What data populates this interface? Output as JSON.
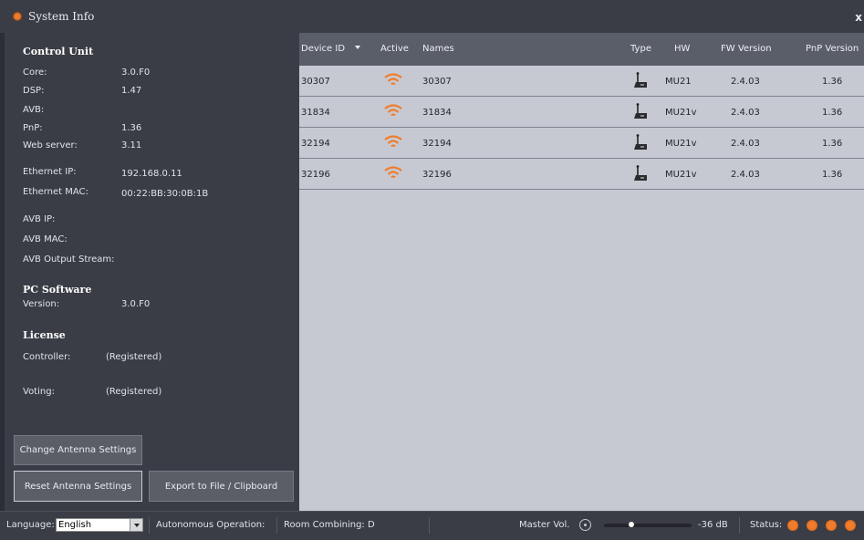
{
  "window": {
    "title": "System Info",
    "close_label": "x"
  },
  "control_unit": {
    "title": "Control Unit",
    "items": [
      {
        "label": "Core:",
        "value": "3.0.F0"
      },
      {
        "label": "DSP:",
        "value": "1.47"
      },
      {
        "label": "AVB:",
        "value": ""
      },
      {
        "label": "PnP:",
        "value": "1.36"
      },
      {
        "label": "Web server:",
        "value": "3.11"
      },
      {
        "label": "Ethernet IP:",
        "value": "192.168.0.11"
      },
      {
        "label": "Ethernet MAC:",
        "value": "00:22:BB:30:0B:1B"
      },
      {
        "label": "AVB IP:",
        "value": ""
      },
      {
        "label": "AVB MAC:",
        "value": ""
      },
      {
        "label": "AVB Output Stream:",
        "value": ""
      }
    ]
  },
  "pc_software": {
    "title": "PC Software",
    "version_label": "Version:",
    "version_value": "3.0.F0"
  },
  "license": {
    "title": "License",
    "items": [
      {
        "label": "Controller:",
        "value": "(Registered)"
      },
      {
        "label": "Voting:",
        "value": "(Registered)"
      }
    ]
  },
  "buttons": {
    "change_antenna": "Change Antenna Settings",
    "reset_antenna": "Reset Antenna Settings",
    "export": "Export to File / Clipboard"
  },
  "table": {
    "headers": {
      "device_id": "Device ID",
      "active": "Active",
      "names": "Names",
      "type": "Type",
      "hw": "HW",
      "fw_version": "FW Version",
      "pnp_version": "PnP Version"
    },
    "rows": [
      {
        "device_id": "30307",
        "name": "30307",
        "hw": "MU21",
        "fw_version": "2.4.03",
        "pnp_version": "1.36"
      },
      {
        "device_id": "31834",
        "name": "31834",
        "hw": "MU21v",
        "fw_version": "2.4.03",
        "pnp_version": "1.36"
      },
      {
        "device_id": "32194",
        "name": "32194",
        "hw": "MU21v",
        "fw_version": "2.4.03",
        "pnp_version": "1.36"
      },
      {
        "device_id": "32196",
        "name": "32196",
        "hw": "MU21v",
        "fw_version": "2.4.03",
        "pnp_version": "1.36"
      }
    ]
  },
  "status_bar": {
    "language_label": "Language:",
    "language_value": "English",
    "autonomous": "Autonomous Operation:",
    "room_combining": "Room Combining: D",
    "master_vol_label": "Master Vol.",
    "master_vol_value": "-36 dB",
    "master_vol_level": 0.3,
    "status_label": "Status:"
  },
  "colors": {
    "accent": "#f07d2c",
    "panel": "#3a3d45",
    "table_bg": "#c6c9d1",
    "header_bg": "#5a5e68"
  },
  "icons": {
    "app": "app-logo-icon",
    "active": "wifi-signal-icon",
    "type": "microphone-unit-icon",
    "status": "status-indicator-icon"
  }
}
